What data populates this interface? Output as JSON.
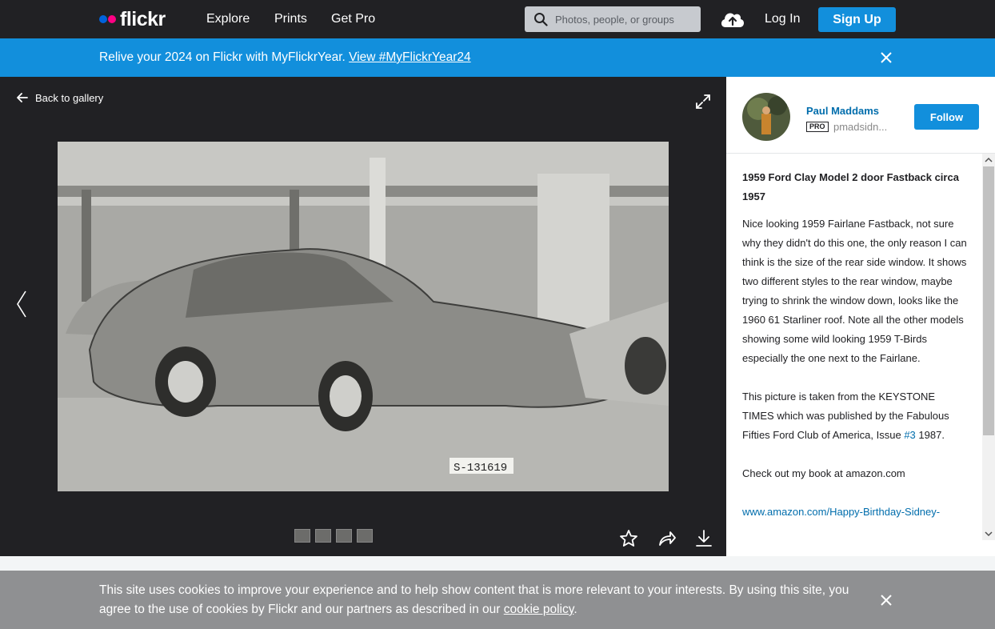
{
  "nav": {
    "logo": "flickr",
    "links": [
      "Explore",
      "Prints",
      "Get Pro"
    ],
    "search_placeholder": "Photos, people, or groups",
    "login": "Log In",
    "signup": "Sign Up"
  },
  "banner": {
    "message": "Relive your 2024 on Flickr with MyFlickrYear.",
    "link": "View #MyFlickrYear24"
  },
  "stage": {
    "back": "Back to gallery",
    "photo_plate": "S-131619"
  },
  "owner": {
    "name": "Paul Maddams",
    "badge": "PRO",
    "handle": "pmadsidn...",
    "follow": "Follow"
  },
  "description": {
    "title": "1959 Ford Clay Model 2 door Fastback circa 1957",
    "p1": "Nice looking 1959 Fairlane Fastback, not sure why they didn't do this one, the only reason I can think is the size of the rear side window. It shows two different styles to the rear window, maybe trying to shrink the window down, looks like the 1960 61 Starliner roof. Note all the other models showing some wild looking 1959 T-Birds especially the one next to the Fairlane.",
    "p2_start": "This picture is taken from the KEYSTONE TIMES which was published by the Fabulous Fifties Ford Club of America, Issue",
    "p2_link": "#3",
    "p2_end": "1987.",
    "p3": "Check out my book at amazon.com",
    "p4_link": "www.amazon.com/Happy-Birthday-Sidney-"
  },
  "cookie": {
    "text": "This site uses cookies to improve your experience and to help show content that is more relevant to your interests. By using this site, you agree to the use of cookies by Flickr and our partners as described in our",
    "link": "cookie policy",
    "end": "."
  },
  "colors": {
    "nav_bg": "#212124",
    "accent": "#128fdc",
    "link": "#006dac"
  },
  "icons": [
    "search-icon",
    "upload-cloud-icon",
    "close-icon",
    "arrow-left-icon",
    "expand-icon",
    "chevron-left-icon",
    "star-icon",
    "share-icon",
    "download-icon"
  ]
}
